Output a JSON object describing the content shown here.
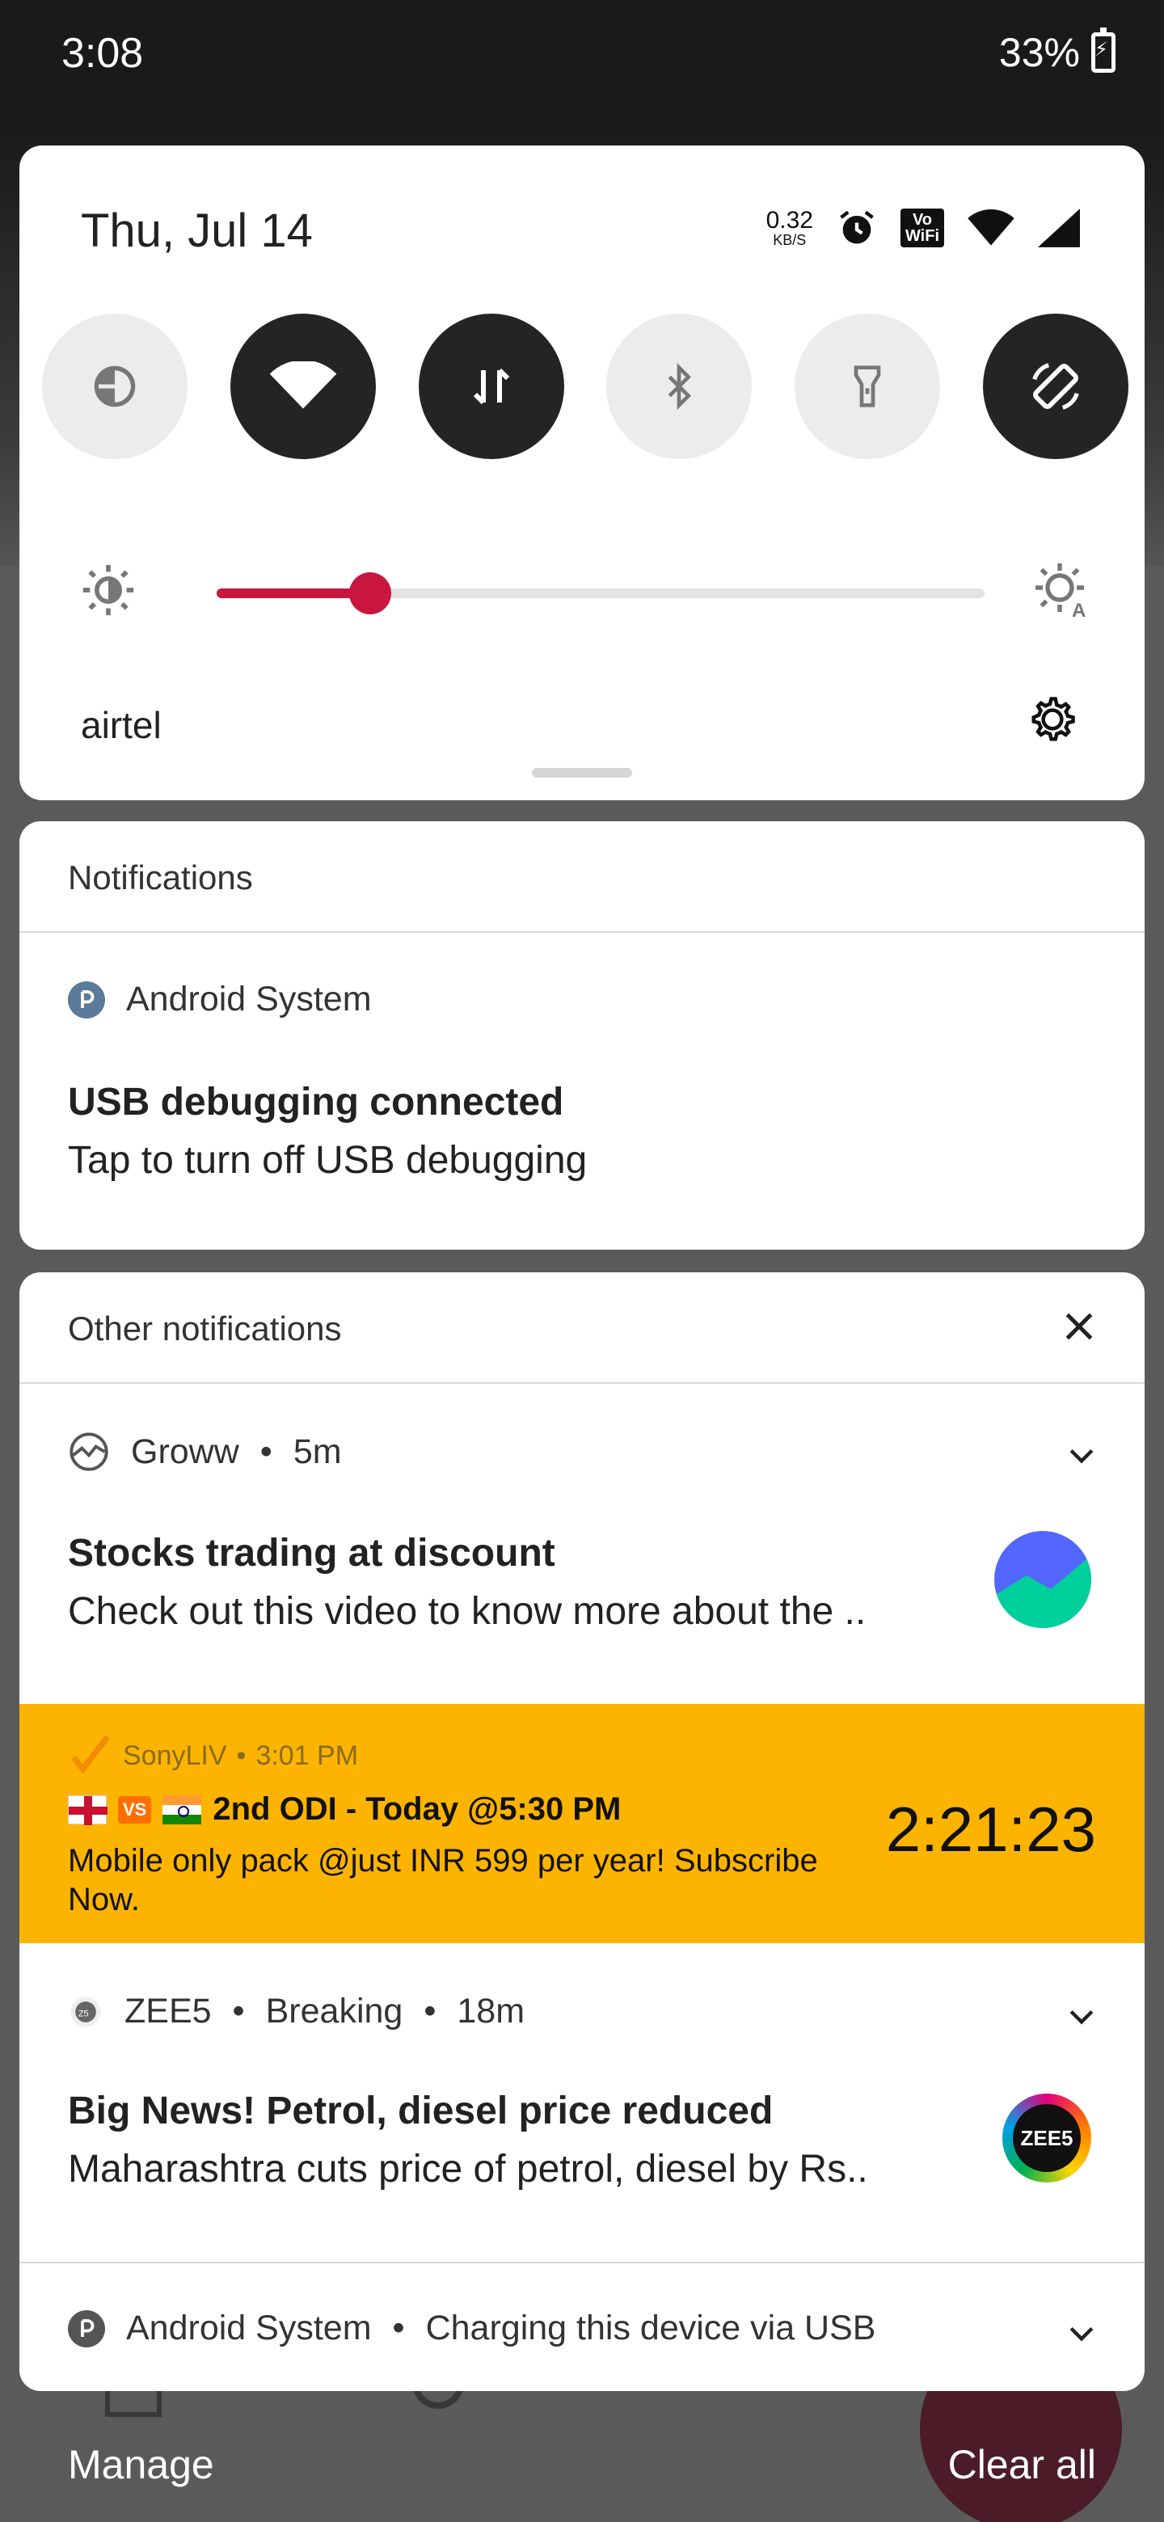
{
  "status_bar": {
    "time": "3:08",
    "battery": "33%"
  },
  "quick_settings": {
    "date": "Thu, Jul 14",
    "net_speed_value": "0.32",
    "net_speed_unit": "KB/S",
    "vowifi_top": "Vo",
    "vowifi_bottom": "WiFi",
    "carrier": "airtel",
    "tiles": [
      {
        "name": "data-saver",
        "on": false
      },
      {
        "name": "wifi",
        "on": true
      },
      {
        "name": "mobile-data",
        "on": true
      },
      {
        "name": "bluetooth",
        "on": false
      },
      {
        "name": "flashlight",
        "on": false
      },
      {
        "name": "auto-rotate",
        "on": true
      }
    ],
    "brightness_level": 0.2,
    "accent_color": "#c8163f"
  },
  "notifications_section": {
    "title": "Notifications",
    "items": [
      {
        "app": "Android System",
        "title": "USB debugging connected",
        "text": "Tap to turn off USB debugging"
      }
    ]
  },
  "other_section": {
    "title": "Other notifications",
    "groww": {
      "app": "Groww",
      "time": "5m",
      "title": "Stocks trading at discount",
      "text": "Check out this video to know more about the .."
    },
    "sonyliv": {
      "app": "SonyLIV",
      "time": "3:01 PM",
      "vs": "VS",
      "headline": "2nd ODI - Today @5:30 PM",
      "text": "Mobile only pack @just INR 599 per year! Subscribe Now.",
      "timer": "2:21:23",
      "bg_color": "#fdb400"
    },
    "zee5": {
      "app": "ZEE5",
      "channel": "Breaking",
      "time": "18m",
      "title": "Big News! Petrol, diesel price reduced",
      "text": "Maharashtra cuts price of petrol, diesel by Rs..",
      "logo_text": "ZEE5"
    },
    "android_charging": {
      "app": "Android System",
      "text": "Charging this device via USB"
    }
  },
  "footer": {
    "manage": "Manage",
    "clear_all": "Clear all"
  }
}
